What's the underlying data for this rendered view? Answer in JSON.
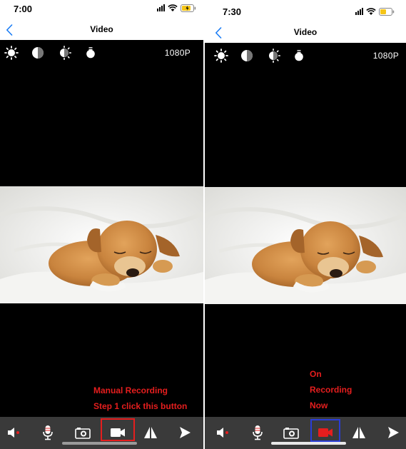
{
  "screens": [
    {
      "status": {
        "time": "7:00"
      },
      "nav": {
        "title": "Video"
      },
      "toolbar": {
        "resolution": "1080P",
        "icons": [
          "brightness-icon",
          "contrast-icon",
          "saturation-icon",
          "light-bulb-icon"
        ]
      },
      "annotation": [
        "Manual Recording",
        "Step 1 click this button"
      ],
      "bottom_bar": {
        "icons": [
          "speaker-mute-icon",
          "microphone-icon",
          "camera-snapshot-icon",
          "video-record-icon",
          "flip-horizontal-icon",
          "play-icon"
        ],
        "record_active": false,
        "highlight_color": "#e51e1e"
      }
    },
    {
      "status": {
        "time": "7:30"
      },
      "nav": {
        "title": "Video"
      },
      "toolbar": {
        "resolution": "1080P",
        "icons": [
          "brightness-icon",
          "contrast-icon",
          "saturation-icon",
          "light-bulb-icon"
        ]
      },
      "annotation": [
        "On",
        "Recording",
        "Now"
      ],
      "bottom_bar": {
        "icons": [
          "speaker-mute-icon",
          "microphone-icon",
          "camera-snapshot-icon",
          "video-record-icon",
          "flip-horizontal-icon",
          "play-icon"
        ],
        "record_active": true,
        "highlight_color": "#2a3dd6",
        "record_icon_color": "#e51e1e"
      }
    }
  ],
  "colors": {
    "accent": "#1a7cf5",
    "annotation": "#e51e1e",
    "bar": "#3a3a3a",
    "video_bg": "#000000"
  }
}
